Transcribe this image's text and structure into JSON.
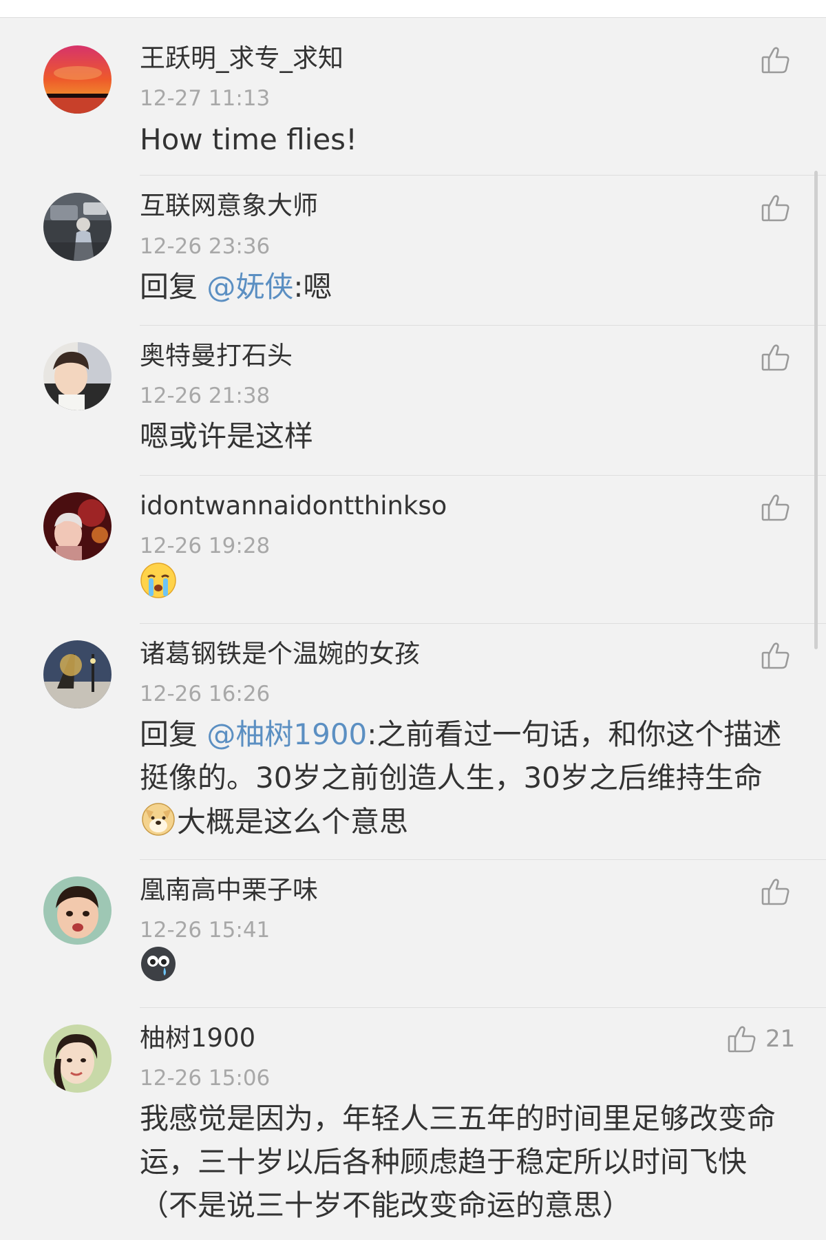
{
  "comments": [
    {
      "username": "王跃明_求专_求知",
      "time": "12-27 11:13",
      "text": "How time flies!",
      "like_icon": "thumbs-up-outline-icon"
    },
    {
      "username": "互联网意象大师",
      "time": "12-26 23:36",
      "reply_prefix": "回复",
      "mention": "@妩侠",
      "text": ":嗯",
      "like_icon": "thumbs-up-outline-icon"
    },
    {
      "username": "奥特曼打石头",
      "time": "12-26 21:38",
      "text": "嗯或许是这样",
      "like_icon": "thumbs-up-outline-icon"
    },
    {
      "username": "idontwannaidontthinkso",
      "time": "12-26 19:28",
      "emoji": "crying-face-emoji",
      "like_icon": "thumbs-up-outline-icon"
    },
    {
      "username": "诸葛钢铁是个温婉的女孩",
      "time": "12-26 16:26",
      "reply_prefix": "回复",
      "mention": "@柚树1900",
      "text_a": ":之前看过一句话，和你这个描述挺像的。30岁之前创造人生，30岁之后维持生命",
      "emoji": "doge-emoji",
      "text_b": "大概是这么个意思",
      "like_icon": "thumbs-up-outline-icon"
    },
    {
      "username": "凰南高中栗子味",
      "time": "12-26 15:41",
      "emoji": "tearful-eyes-emoji",
      "like_icon": "thumbs-up-outline-icon"
    },
    {
      "username": "柚树1900",
      "time": "12-26 15:06",
      "text": "我感觉是因为，年轻人三五年的时间里足够改变命运，三十岁以后各种顾虑趋于稳定所以时间飞快（不是说三十岁不能改变命运的意思）",
      "like_icon": "thumbs-up-outline-icon",
      "like_count": "21"
    }
  ],
  "colors": {
    "background": "#f2f2f2",
    "text": "#333333",
    "time": "#a8a8a8",
    "mention": "#5b8fc2",
    "icon": "#9a9a9a"
  }
}
